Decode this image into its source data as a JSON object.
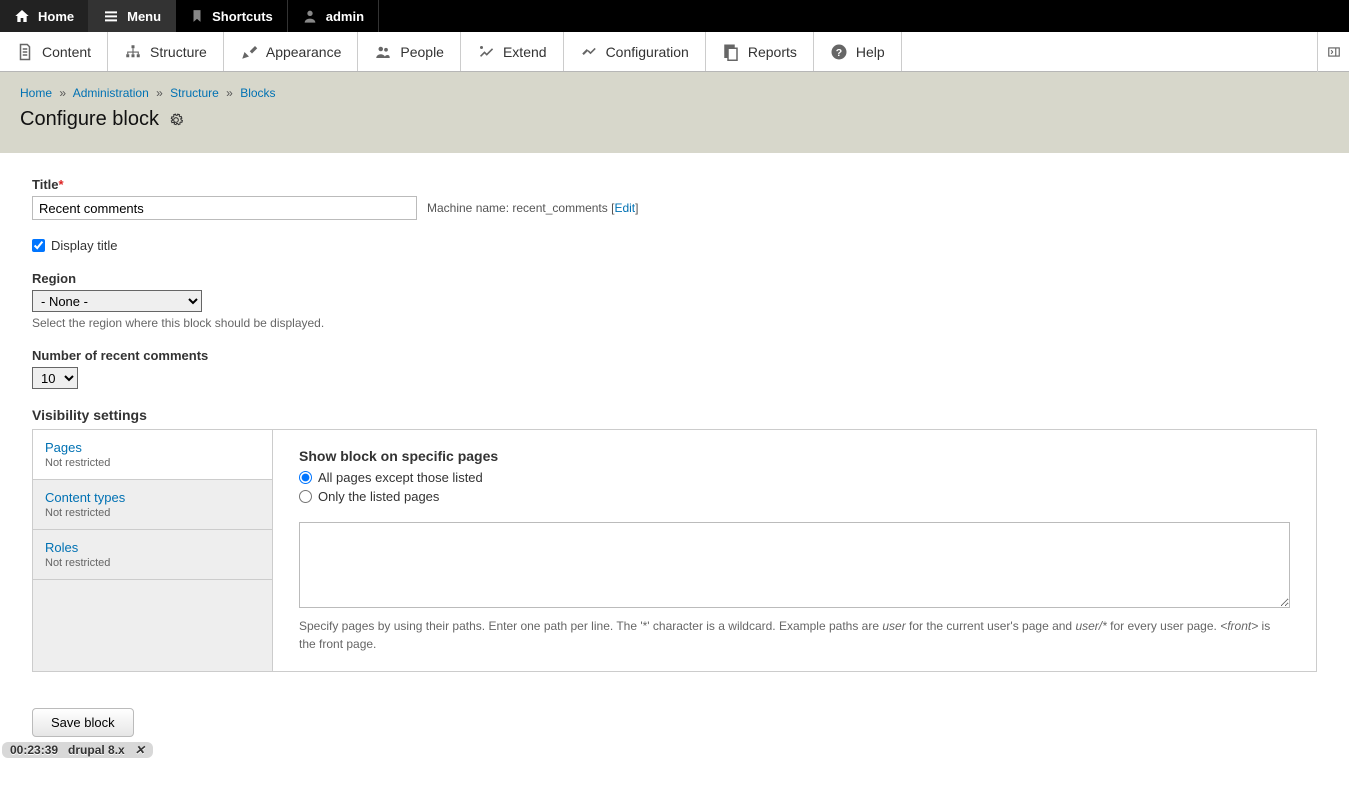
{
  "topbar": {
    "home": "Home",
    "menu": "Menu",
    "shortcuts": "Shortcuts",
    "user": "admin"
  },
  "adminbar": {
    "items": [
      {
        "label": "Content"
      },
      {
        "label": "Structure"
      },
      {
        "label": "Appearance"
      },
      {
        "label": "People"
      },
      {
        "label": "Extend"
      },
      {
        "label": "Configuration"
      },
      {
        "label": "Reports"
      },
      {
        "label": "Help"
      }
    ]
  },
  "breadcrumb": {
    "home": "Home",
    "administration": "Administration",
    "structure": "Structure",
    "blocks": "Blocks"
  },
  "page_title": "Configure block",
  "form": {
    "title_label": "Title",
    "title_value": "Recent comments",
    "machine_name_label": "Machine name: ",
    "machine_name_value": "recent_comments",
    "machine_name_edit": "Edit",
    "display_title_label": "Display title",
    "region_label": "Region",
    "region_value": "- None -",
    "region_help": "Select the region where this block should be displayed.",
    "num_comments_label": "Number of recent comments",
    "num_comments_value": "10",
    "visibility_label": "Visibility settings",
    "vtabs": [
      {
        "title": "Pages",
        "sub": "Not restricted"
      },
      {
        "title": "Content types",
        "sub": "Not restricted"
      },
      {
        "title": "Roles",
        "sub": "Not restricted"
      }
    ],
    "panel": {
      "heading": "Show block on specific pages",
      "radio1": "All pages except those listed",
      "radio2": "Only the listed pages",
      "help_pre": "Specify pages by using their paths. Enter one path per line. The '*' character is a wildcard. Example paths are ",
      "help_em1": "user",
      "help_mid1": " for the current user's page and ",
      "help_em2": "user/*",
      "help_mid2": " for every user page. ",
      "help_em3": "<front>",
      "help_post": " is the front page."
    },
    "save_label": "Save block"
  },
  "footer": {
    "time": "00:23:39",
    "label": "drupal 8.x"
  }
}
